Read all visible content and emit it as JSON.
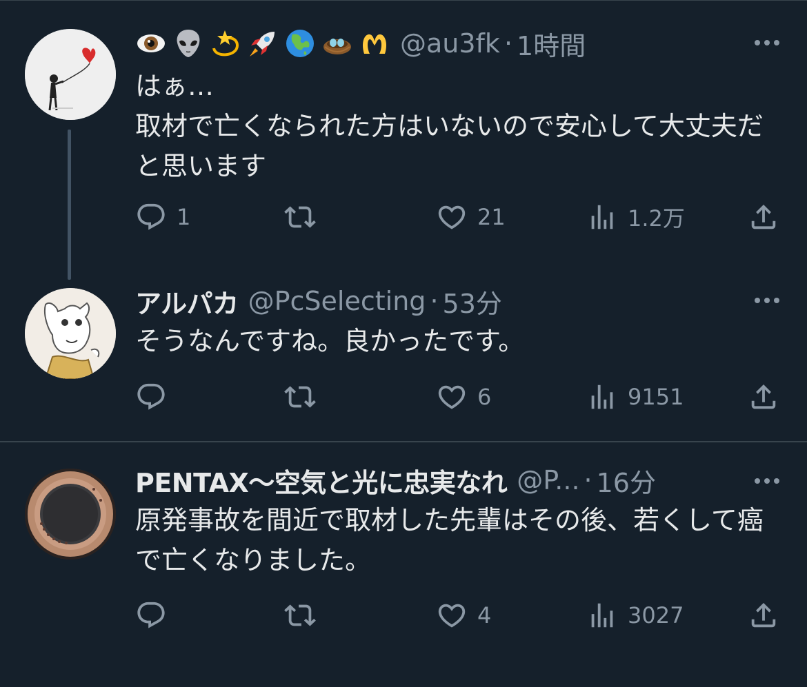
{
  "tweets": [
    {
      "name": "",
      "emoji_name": [
        "eye",
        "alien",
        "dizzy",
        "rocket",
        "globe-asia",
        "nest-with-eggs",
        "heart-hands"
      ],
      "handle": "@au3fk",
      "time": "1時間",
      "text": "はぁ…\n取材で亡くなられた方はいないので安心して大丈夫だと思います",
      "replies": "1",
      "retweets": "",
      "likes": "21",
      "views": "1.2万"
    },
    {
      "name": "アルパカ",
      "handle": "@PcSelecting",
      "time": "53分",
      "text": "そうなんですね。良かったです。",
      "replies": "",
      "retweets": "",
      "likes": "6",
      "views": "9151"
    },
    {
      "name": "PENTAX〜空気と光に忠実なれ",
      "handle": "@P...",
      "time": "16分",
      "text": "原発事故を間近で取材した先輩はその後、若くして癌で亡くなりました。",
      "replies": "",
      "retweets": "",
      "likes": "4",
      "views": "3027"
    }
  ],
  "colors": {
    "background": "#15202b",
    "text": "#e7e9ea",
    "muted": "#8b98a5",
    "divider": "#38444d"
  },
  "icons": {
    "reply": "reply-icon",
    "retweet": "retweet-icon",
    "like": "heart-icon",
    "views": "views-bar-icon",
    "share": "share-icon",
    "more": "more-dots-icon"
  }
}
